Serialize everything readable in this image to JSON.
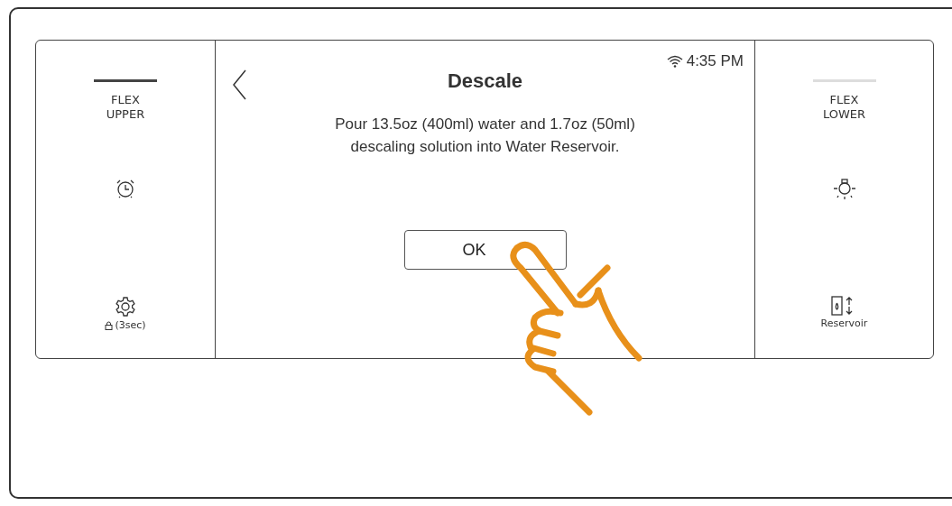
{
  "left_panel": {
    "zone": {
      "label": "FLEX\nUPPER",
      "selected": true
    },
    "buttons": [
      {
        "kind": "timer"
      },
      {
        "kind": "settings",
        "label": "(3sec)"
      }
    ]
  },
  "main": {
    "time": "4:35 PM",
    "title": "Descale",
    "message": "Pour 13.5oz (400ml) water and 1.7oz (50ml)\ndescaling solution into Water Reservoir.",
    "ok_button": "OK"
  },
  "right_panel": {
    "zone": {
      "label": "FLEX\nLOWER",
      "selected": false
    },
    "buttons": [
      {
        "kind": "light"
      },
      {
        "kind": "reservoir",
        "label": "Reservoir"
      }
    ]
  }
}
